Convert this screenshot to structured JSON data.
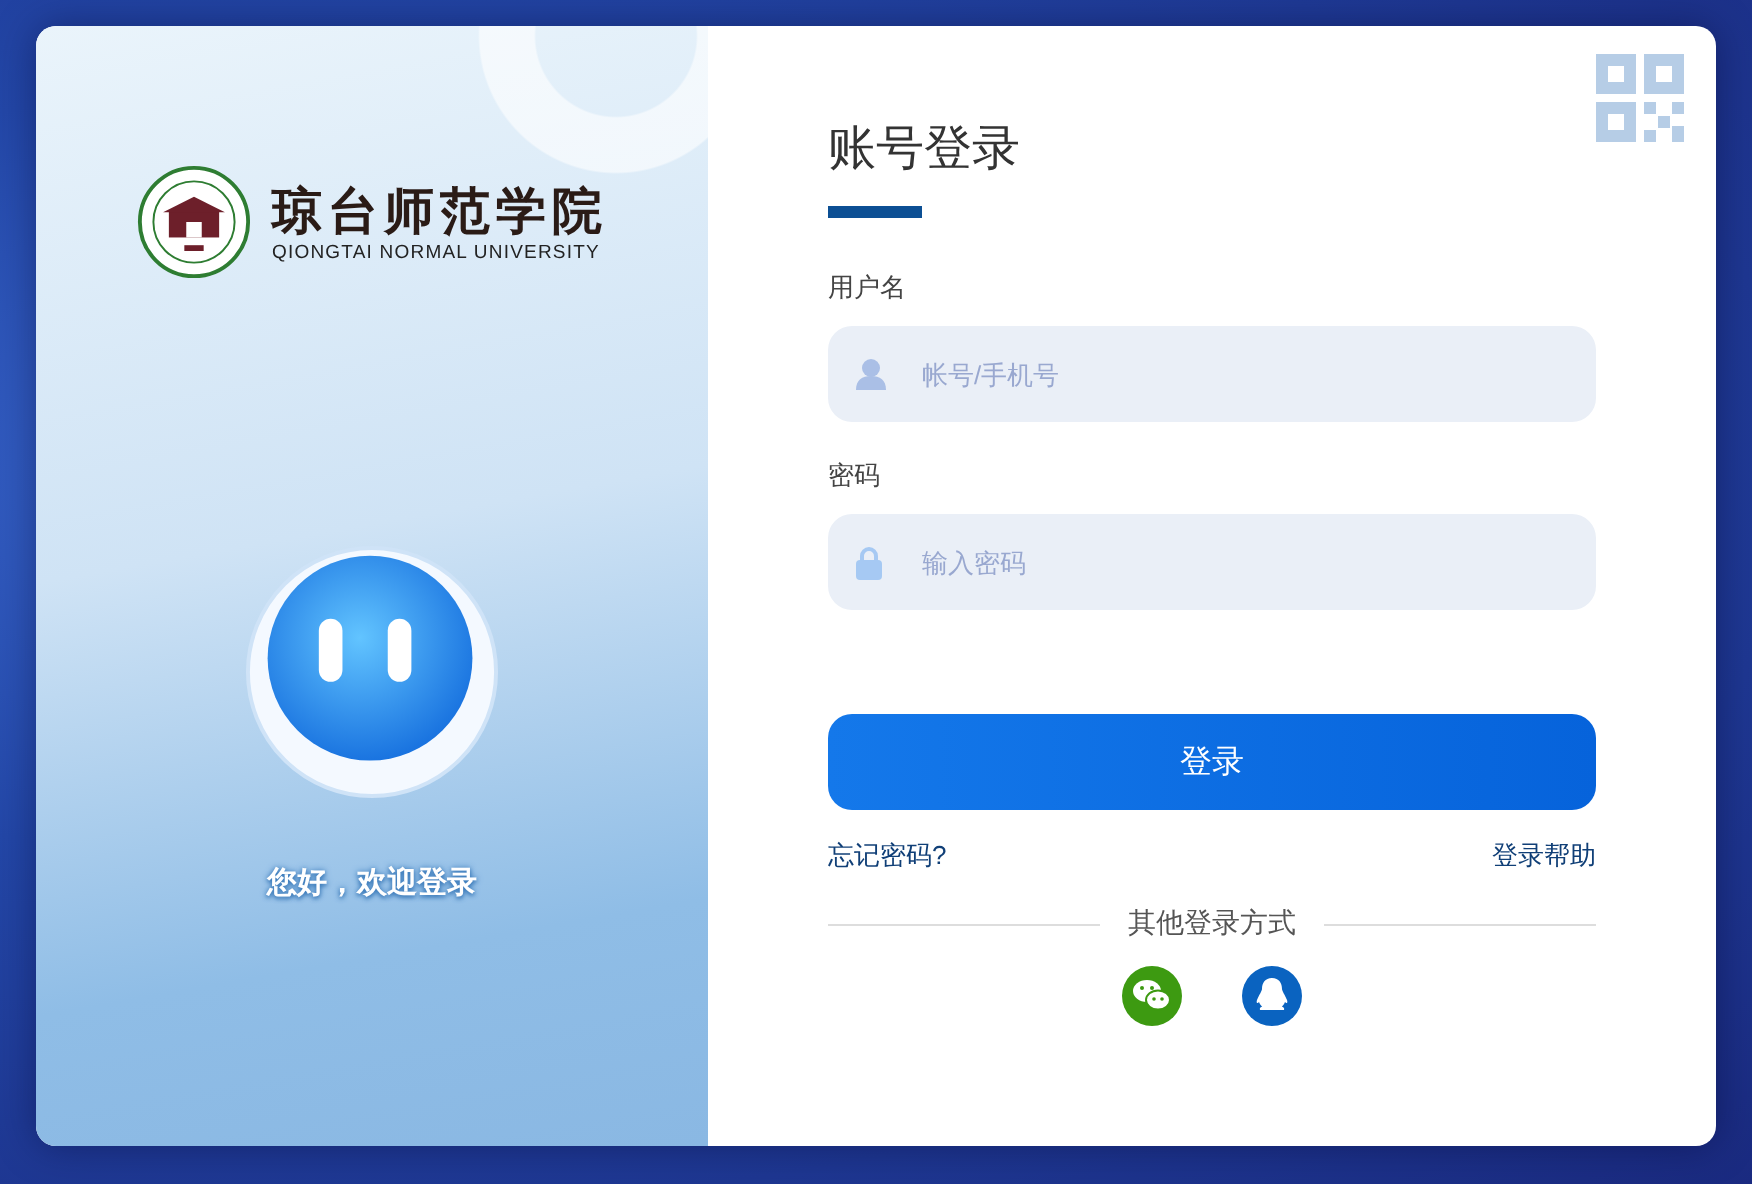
{
  "brand": {
    "name": "琼台师范学院",
    "name_en": "QIONGTAI NORMAL UNIVERSITY"
  },
  "welcome": "您好，欢迎登录",
  "title": "账号登录",
  "fields": [
    {
      "label": "用户名",
      "placeholder": "帐号/手机号",
      "kind": "user"
    },
    {
      "label": "密码",
      "placeholder": "输入密码",
      "kind": "password"
    }
  ],
  "login_button": "登录",
  "links": {
    "forgot": "忘记密码?",
    "help": "登录帮助"
  },
  "other_login": {
    "label": "其他登录方式",
    "methods": [
      {
        "kind": "wechat"
      },
      {
        "kind": "qq"
      }
    ]
  }
}
